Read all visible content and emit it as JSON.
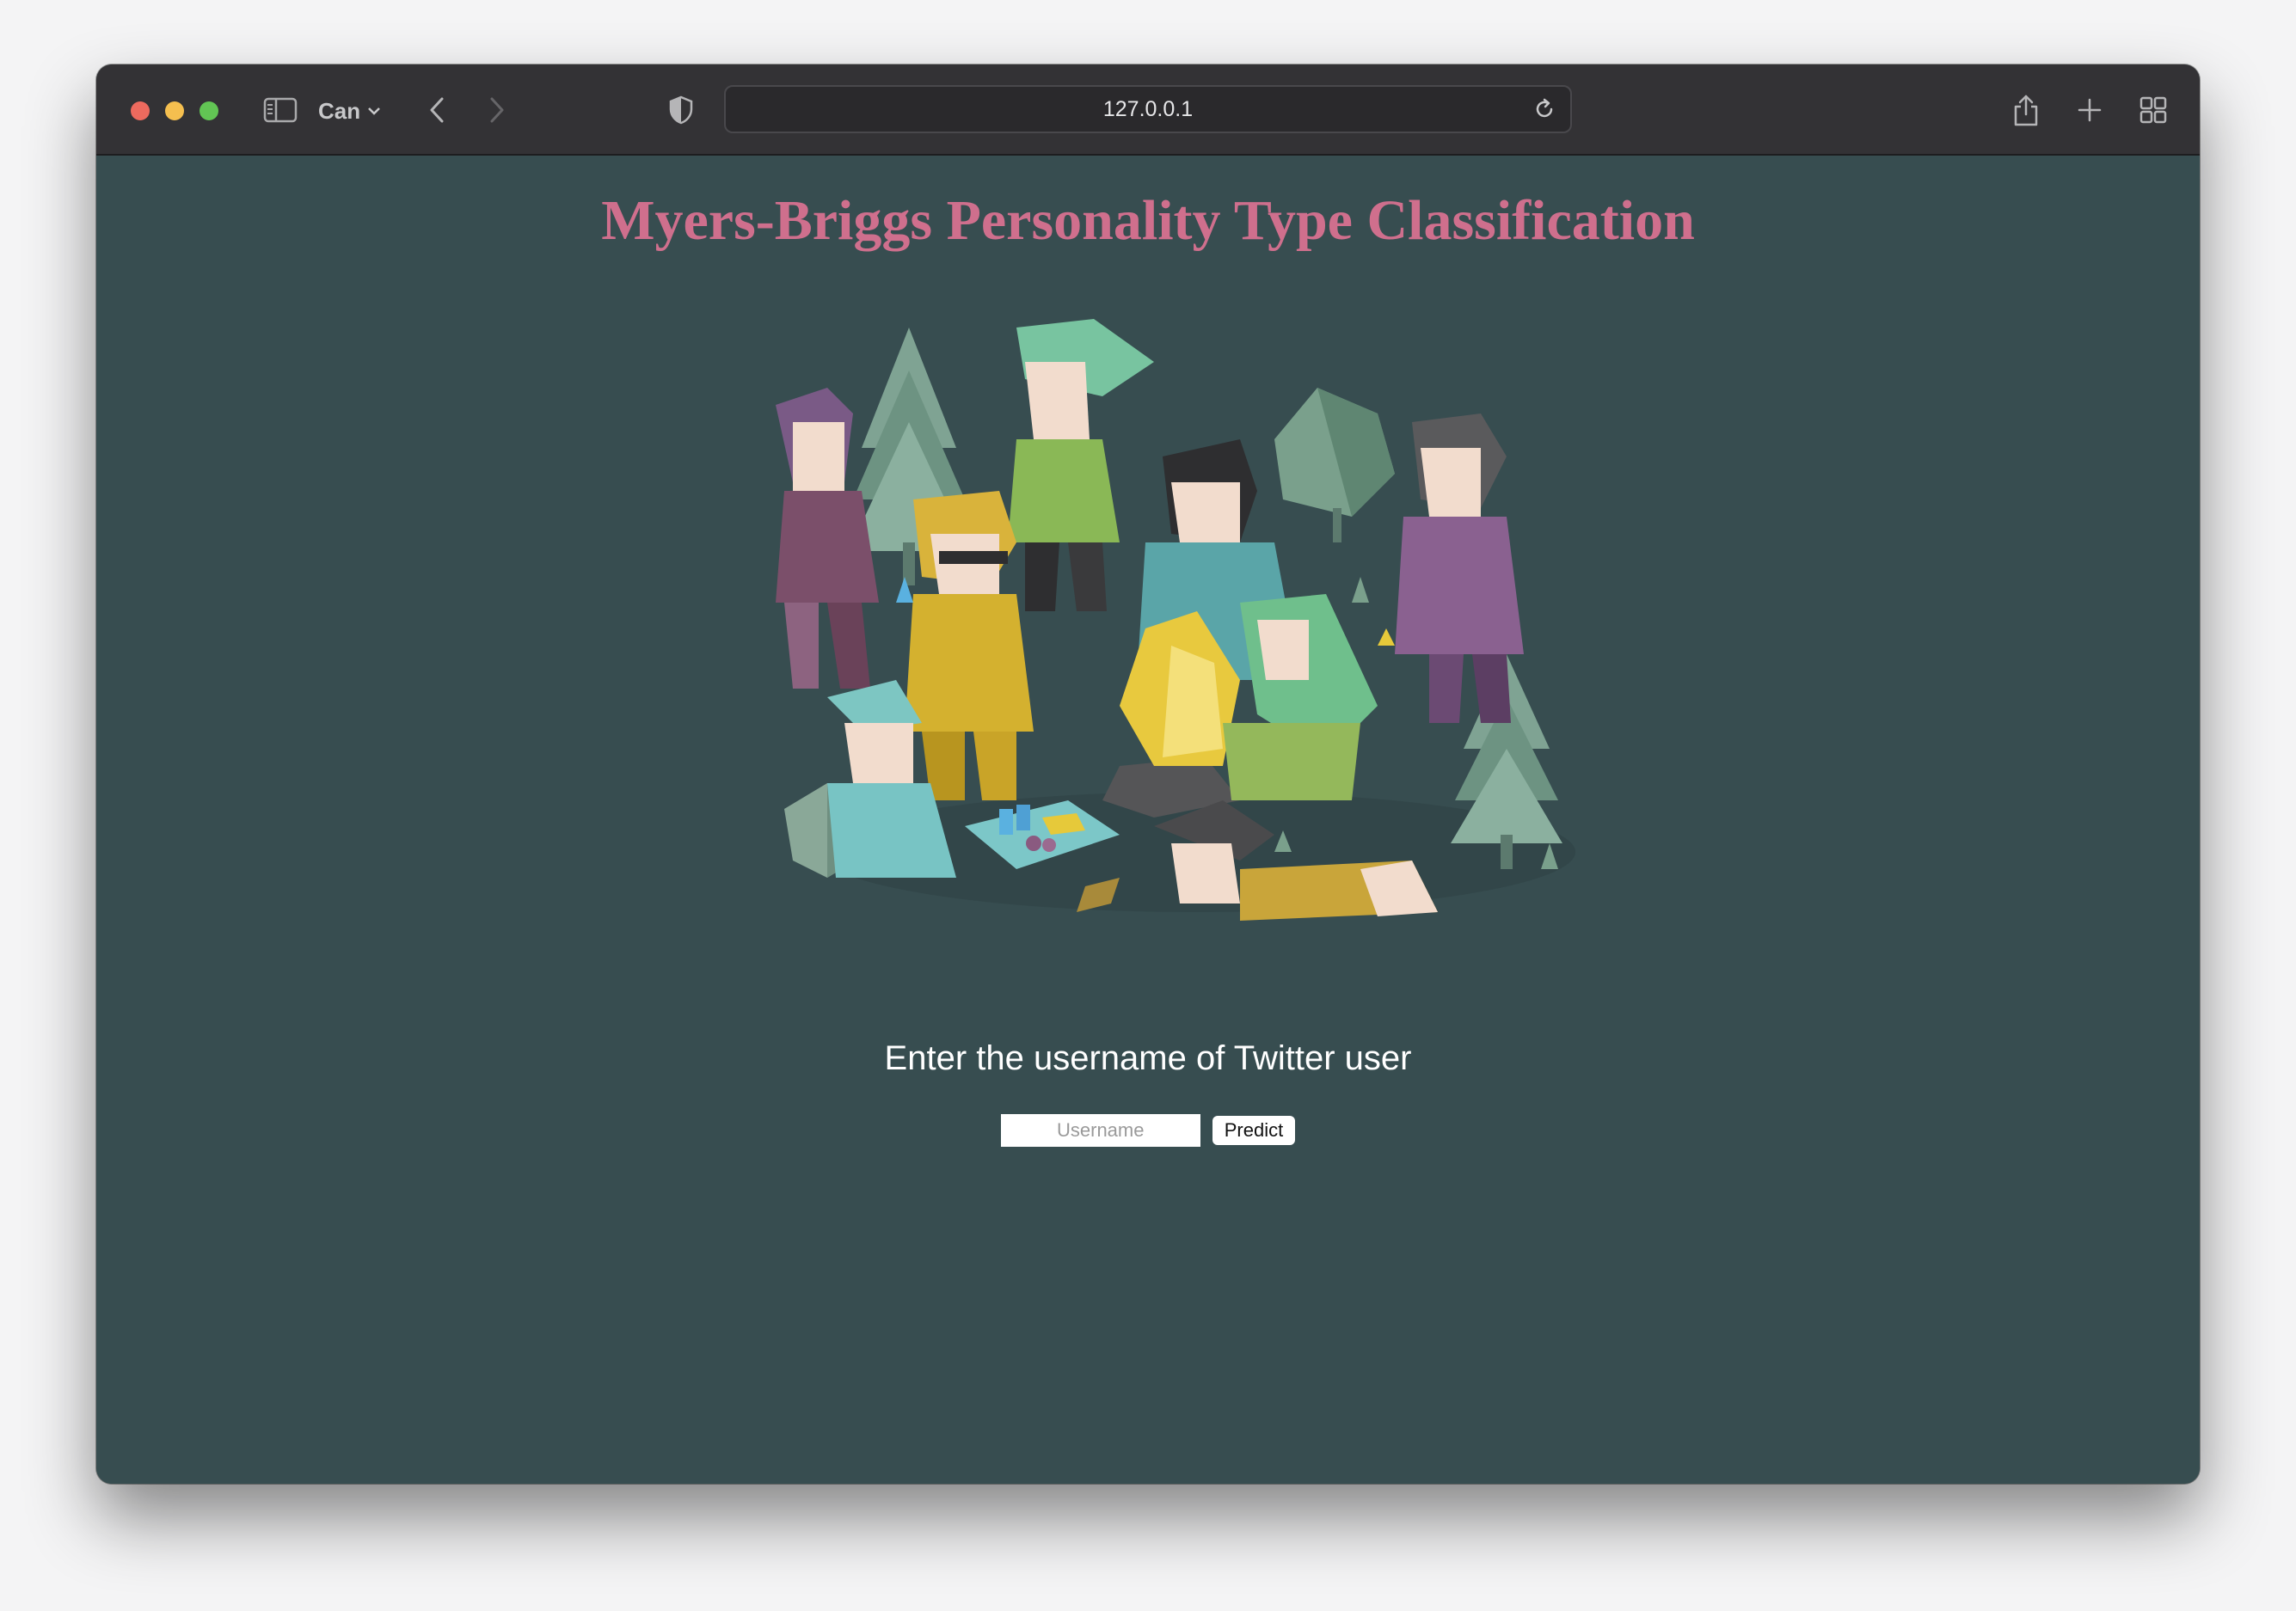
{
  "browser": {
    "tab_label": "Can",
    "url": "127.0.0.1",
    "icons": [
      "sidebar-icon",
      "chevron-down-icon",
      "back-icon",
      "forward-icon",
      "shield-icon",
      "reload-icon",
      "share-icon",
      "new-tab-icon",
      "tab-overview-icon"
    ]
  },
  "page": {
    "title": "Myers-Briggs Personality Type Classification",
    "prompt": "Enter the username of Twitter user",
    "input_placeholder": "Username",
    "input_value": "",
    "button_label": "Predict",
    "colors": {
      "background": "#374d50",
      "title": "#cf6f8d"
    }
  }
}
